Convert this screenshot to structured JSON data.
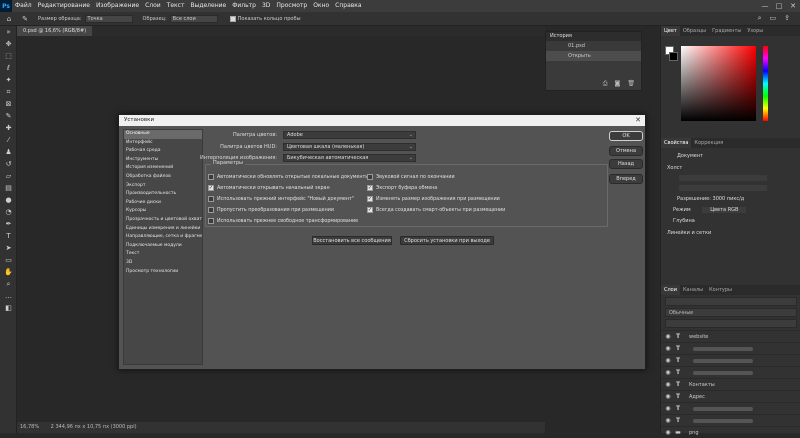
{
  "menubar": {
    "logo": "Ps",
    "items": [
      "Файл",
      "Редактирование",
      "Изображение",
      "Слои",
      "Текст",
      "Выделение",
      "Фильтр",
      "3D",
      "Просмотр",
      "Окно",
      "Справка"
    ],
    "win": [
      "—",
      "□",
      "✕"
    ]
  },
  "options": {
    "size_label": "Размер образца:",
    "size_value": "Точка",
    "sample_label": "Образец:",
    "sample_value": "Все слои",
    "ring_label": "Показать кольцо пробы"
  },
  "document": {
    "tab": "0.psd @ 16,6% (RGB/8#)",
    "status": "16,78%",
    "status_size": "2 344,96 пх x 10,75 пх (3000 ppi)"
  },
  "history": {
    "title": "История",
    "items": [
      "01.psd",
      "Открыть"
    ]
  },
  "color_panel": {
    "tabs": [
      "Цвет",
      "Образцы",
      "Градиенты",
      "Узоры"
    ]
  },
  "properties": {
    "tabs": [
      "Свойства",
      "Коррекция"
    ],
    "subtitle": "Документ",
    "section1": "Холст",
    "resolution": "Разрешение: 3000 пикс/д",
    "mode_label": "Режим",
    "mode_value": "Цвета RGB",
    "depth_label": "Глубина",
    "section2": "Линейки и сетки"
  },
  "layers": {
    "tabs": [
      "Слои",
      "Каналы",
      "Контуры"
    ],
    "kind": "Обычные",
    "rows": [
      {
        "type": "T",
        "label": "website"
      },
      {
        "type": "T",
        "label": ""
      },
      {
        "type": "T",
        "label": ""
      },
      {
        "type": "T",
        "label": ""
      },
      {
        "type": "T",
        "label": "Контакты"
      },
      {
        "type": "T",
        "label": "Адрес"
      },
      {
        "type": "T",
        "label": ""
      },
      {
        "type": "T",
        "label": ""
      },
      {
        "type": "F",
        "label": "png"
      }
    ]
  },
  "dialog": {
    "title": "Установки",
    "categories": [
      "Основные",
      "Интерфейс",
      "Рабочая среда",
      "Инструменты",
      "История изменений",
      "Обработка файлов",
      "Экспорт",
      "Производительность",
      "Рабочие диски",
      "Курсоры",
      "Прозрачность и цветовой охват",
      "Единицы измерения и линейки",
      "Направляющие, сетка и фрагменты",
      "Подключаемые модули",
      "Текст",
      "3D",
      "Просмотр технологии"
    ],
    "color_picker_label": "Палитра цветов:",
    "color_picker_value": "Adobe",
    "hud_label": "Палитра цветов HUD:",
    "hud_value": "Цветовая шкала (маленькая)",
    "interp_label": "Интерполяция изображения:",
    "interp_value": "Бикубическая автоматическая",
    "params_label": "Параметры",
    "checks_left": [
      {
        "label": "Автоматически обновлять открытые локальные документы",
        "on": false
      },
      {
        "label": "Автоматически открывать начальный экран",
        "on": true
      },
      {
        "label": "Использовать прежний интерфейс \"Новый документ\"",
        "on": false
      },
      {
        "label": "Пропустить преобразования при размещении",
        "on": false
      },
      {
        "label": "Использовать прежнее свободное трансформирование",
        "on": false
      }
    ],
    "checks_right": [
      {
        "label": "Звуковой сигнал по окончании",
        "on": false
      },
      {
        "label": "Экспорт буфера обмена",
        "on": true
      },
      {
        "label": "Изменять размер изображения при размещении",
        "on": true
      },
      {
        "label": "Всегда создавать смарт-объекты при размещении",
        "on": true
      }
    ],
    "reset_warnings": "Восстановить все сообщения",
    "reset_on_quit": "Сбросить установки при выходе",
    "ok": "OK",
    "cancel": "Отмена",
    "prev": "Назад",
    "next": "Вперед"
  }
}
